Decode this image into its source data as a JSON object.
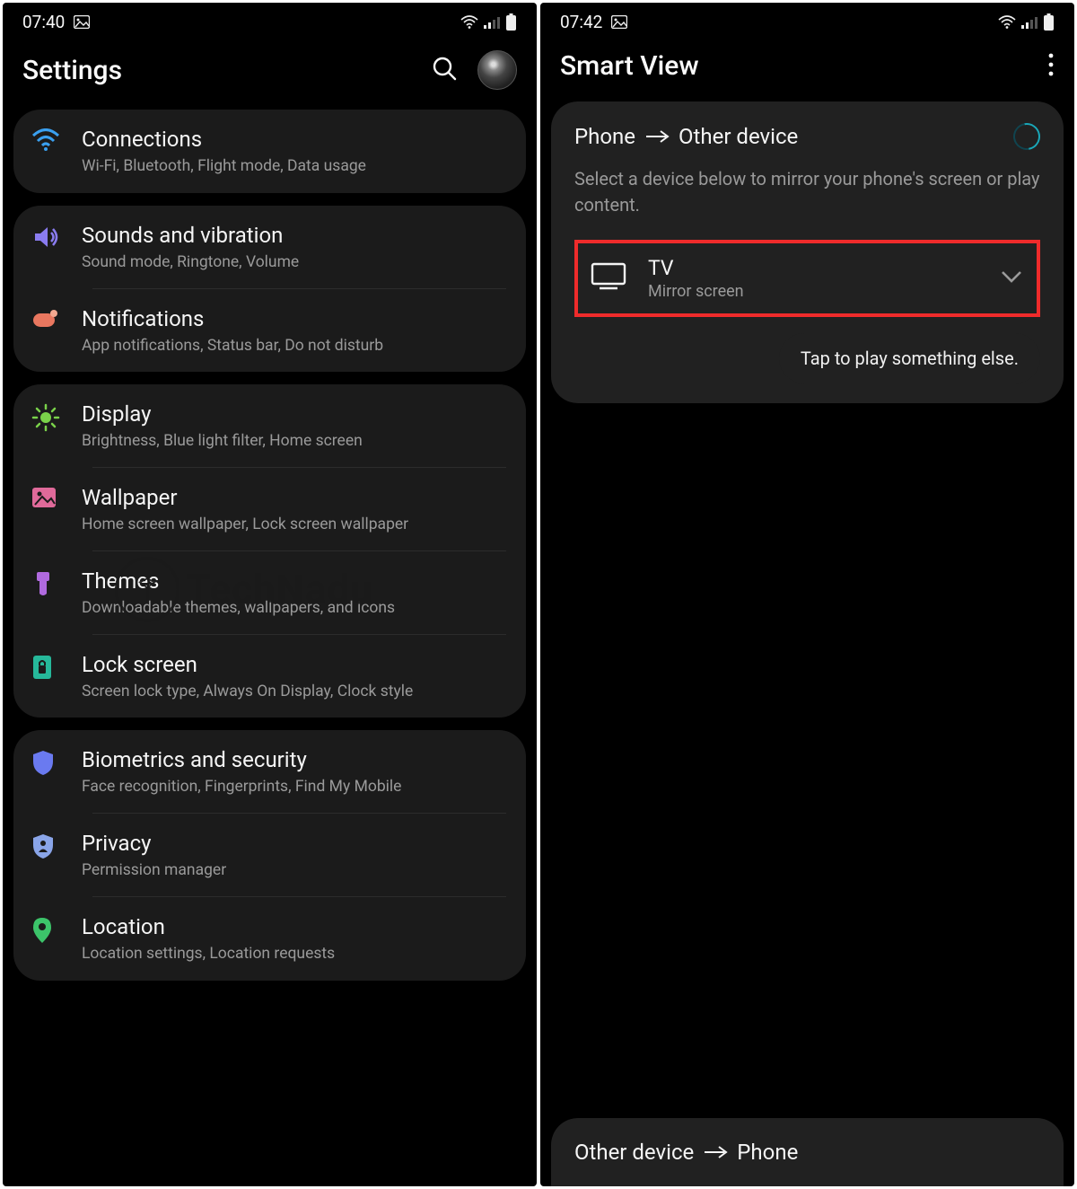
{
  "left": {
    "status": {
      "time": "07:40"
    },
    "header": {
      "title": "Settings"
    },
    "groups": [
      {
        "items": [
          {
            "icon": "wifi-icon",
            "title": "Connections",
            "sub": "Wi-Fi, Bluetooth, Flight mode, Data usage",
            "color": "#3aa0f0"
          }
        ]
      },
      {
        "items": [
          {
            "icon": "sound-icon",
            "title": "Sounds and vibration",
            "sub": "Sound mode, Ringtone, Volume",
            "color": "#8a7cf0"
          },
          {
            "icon": "notification-icon",
            "title": "Notifications",
            "sub": "App notifications, Status bar, Do not disturb",
            "color": "#e9775f"
          }
        ]
      },
      {
        "items": [
          {
            "icon": "brightness-icon",
            "title": "Display",
            "sub": "Brightness, Blue light filter, Home screen",
            "color": "#7ad24a"
          },
          {
            "icon": "wallpaper-icon",
            "title": "Wallpaper",
            "sub": "Home screen wallpaper, Lock screen wallpaper",
            "color": "#e06a9a"
          },
          {
            "icon": "themes-icon",
            "title": "Themes",
            "sub": "Downloadable themes, wallpapers, and icons",
            "color": "#b06adf"
          },
          {
            "icon": "lock-icon",
            "title": "Lock screen",
            "sub": "Screen lock type, Always On Display, Clock style",
            "color": "#26b89a"
          }
        ]
      },
      {
        "items": [
          {
            "icon": "shield-icon",
            "title": "Biometrics and security",
            "sub": "Face recognition, Fingerprints, Find My Mobile",
            "color": "#6a7af0"
          },
          {
            "icon": "privacy-icon",
            "title": "Privacy",
            "sub": "Permission manager",
            "color": "#8aa5e8"
          },
          {
            "icon": "location-icon",
            "title": "Location",
            "sub": "Location settings, Location requests",
            "color": "#3cc46a"
          }
        ]
      }
    ]
  },
  "right": {
    "status": {
      "time": "07:42"
    },
    "header": {
      "title": "Smart View"
    },
    "panel": {
      "heading_prefix": "Phone",
      "heading_suffix": "Other device",
      "desc": "Select a device below to mirror your phone's screen or play content.",
      "device": {
        "title": "TV",
        "sub": "Mirror screen"
      },
      "chip": "Tap to play something else."
    },
    "bottom": {
      "prefix": "Other device",
      "suffix": "Phone"
    }
  },
  "watermark": "TechNadu"
}
